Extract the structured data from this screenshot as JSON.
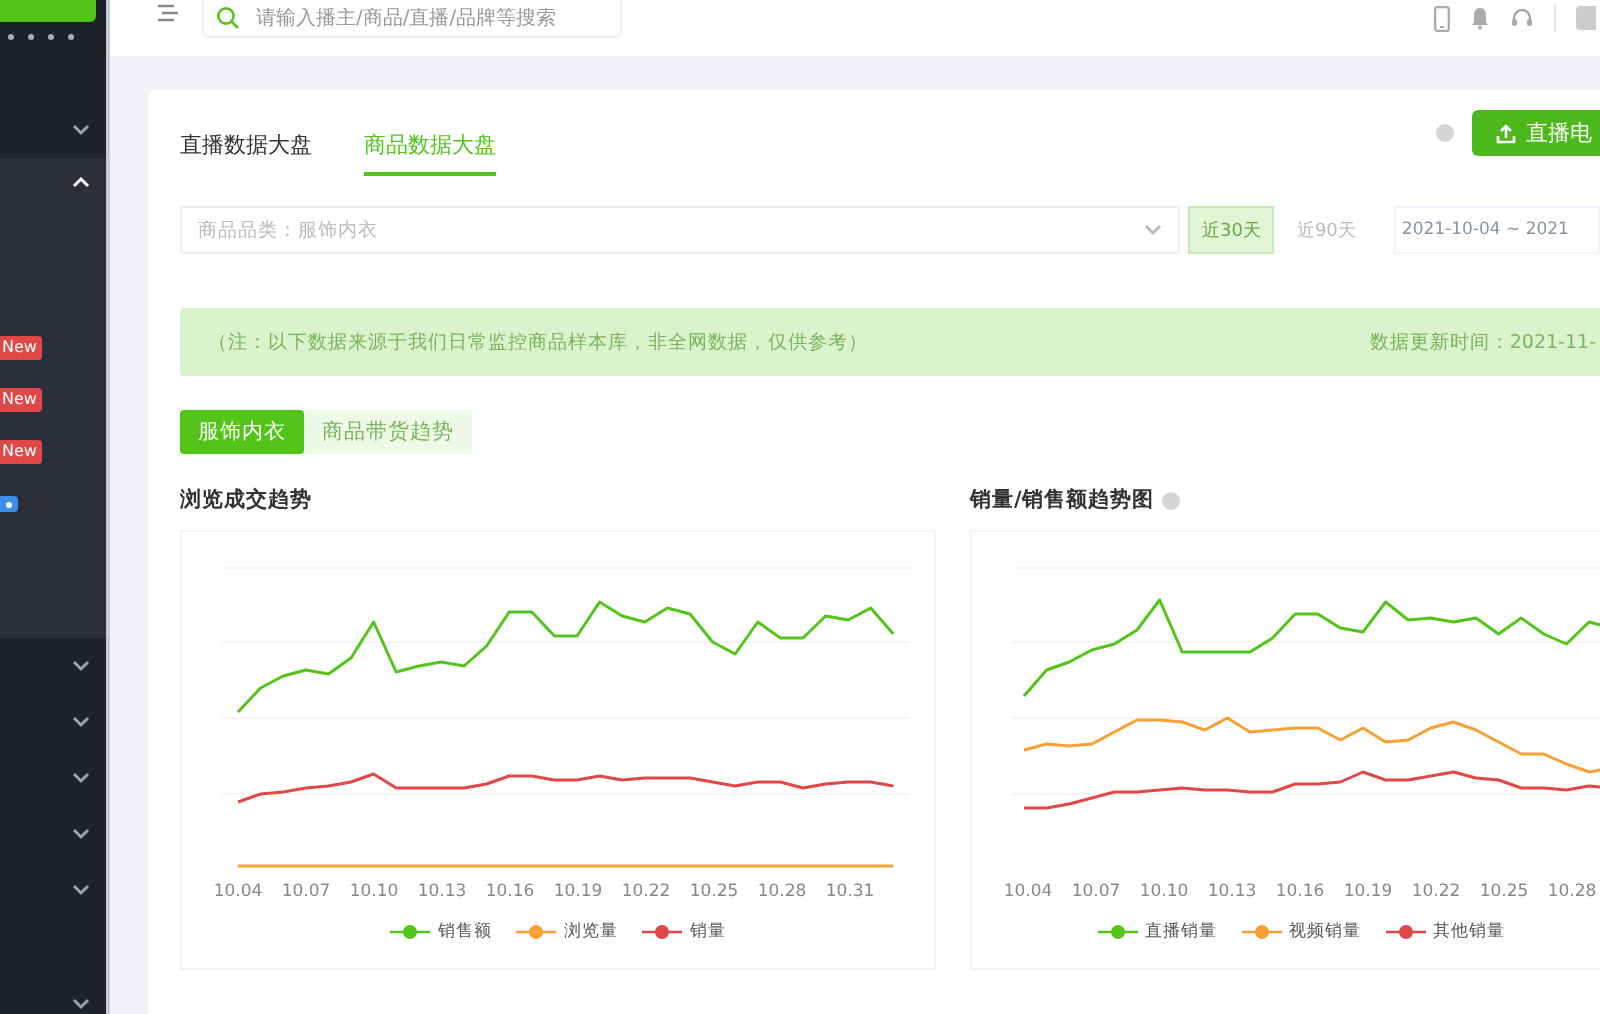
{
  "sidebar": {
    "groups": [
      {
        "expanded": false
      },
      {
        "expanded": true,
        "children": [
          {
            "kind": "new",
            "badge": "New"
          },
          {
            "kind": "new",
            "badge": "New"
          },
          {
            "kind": "new",
            "badge": "New"
          },
          {
            "kind": "tag"
          }
        ]
      },
      {
        "expanded": false
      },
      {
        "expanded": false
      },
      {
        "expanded": false
      },
      {
        "expanded": false
      },
      {
        "expanded": false
      },
      {
        "expanded": false
      }
    ]
  },
  "header": {
    "search": {
      "placeholder": "请输入播主/商品/直播/品牌等搜索"
    }
  },
  "card": {
    "tabs": [
      {
        "label": "直播数据大盘",
        "selected": false
      },
      {
        "label": "商品数据大盘",
        "selected": true
      }
    ],
    "export_button": "直播电",
    "category_select": {
      "value": "商品品类：服饰内衣"
    },
    "ranges": [
      {
        "label": "近30天",
        "selected": true
      },
      {
        "label": "近90天",
        "selected": false
      }
    ],
    "date_range": "2021-10-04 ~ 2021",
    "notice": {
      "text": "（注：以下数据来源于我们日常监控商品样本库，非全网数据，仅供参考）",
      "updated": "数据更新时间：2021-11-"
    },
    "subtabs": [
      {
        "label": "服饰内衣",
        "selected": true
      },
      {
        "label": "商品带货趋势",
        "selected": false
      }
    ],
    "charts": [
      {
        "title": "浏览成交趋势",
        "help": false,
        "x_labels": [
          "10.04",
          "10.07",
          "10.10",
          "10.13",
          "10.16",
          "10.19",
          "10.22",
          "10.25",
          "10.28",
          "10.31"
        ],
        "legend": [
          {
            "label": "销售额",
            "color": "#52c41a"
          },
          {
            "label": "浏览量",
            "color": "#f7a035"
          },
          {
            "label": "销量",
            "color": "#e04848"
          }
        ]
      },
      {
        "title": "销量/销售额趋势图",
        "help": true,
        "x_labels": [
          "10.04",
          "10.07",
          "10.10",
          "10.13",
          "10.16",
          "10.19",
          "10.22",
          "10.25",
          "10.28"
        ],
        "legend": [
          {
            "label": "直播销量",
            "color": "#52c41a"
          },
          {
            "label": "视频销量",
            "color": "#f7a035"
          },
          {
            "label": "其他销量",
            "color": "#e04848"
          }
        ]
      }
    ]
  }
}
